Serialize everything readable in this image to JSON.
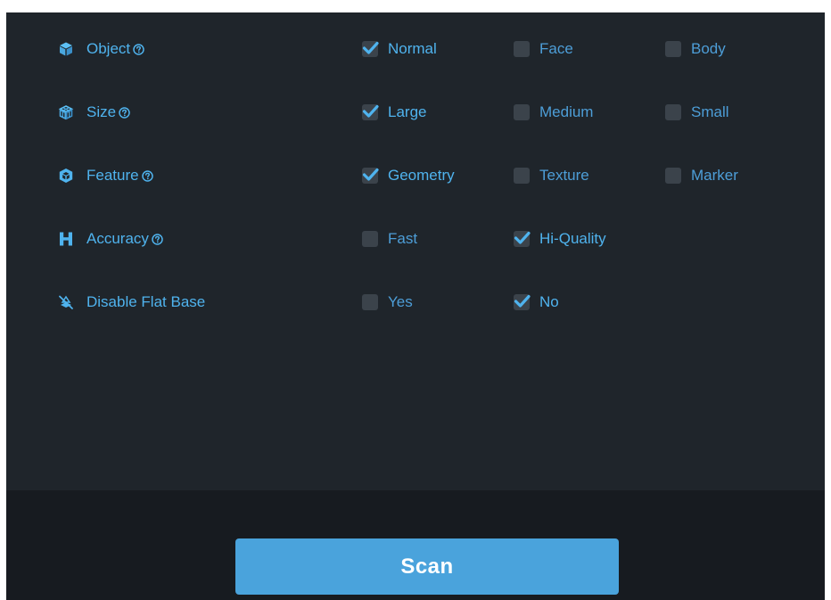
{
  "colors": {
    "panel_bg": "#1f252b",
    "footer_bg": "#171b20",
    "accent": "#4fb3ee",
    "checkbox_bg": "#3b434b",
    "scan_button_bg": "#4aa3dc"
  },
  "rows": [
    {
      "label": "Object",
      "icon": "cube-icon",
      "help": true,
      "options": [
        {
          "label": "Normal",
          "checked": true
        },
        {
          "label": "Face",
          "checked": false
        },
        {
          "label": "Body",
          "checked": false
        }
      ]
    },
    {
      "label": "Size",
      "icon": "cube-grid-icon",
      "help": true,
      "options": [
        {
          "label": "Large",
          "checked": true
        },
        {
          "label": "Medium",
          "checked": false
        },
        {
          "label": "Small",
          "checked": false
        }
      ]
    },
    {
      "label": "Feature",
      "icon": "feature-cube-icon",
      "help": true,
      "options": [
        {
          "label": "Geometry",
          "checked": true
        },
        {
          "label": "Texture",
          "checked": false
        },
        {
          "label": "Marker",
          "checked": false
        }
      ]
    },
    {
      "label": "Accuracy",
      "icon": "h-letter-icon",
      "help": true,
      "options": [
        {
          "label": "Fast",
          "checked": false
        },
        {
          "label": "Hi-Quality",
          "checked": true
        }
      ]
    },
    {
      "label": "Disable Flat Base",
      "icon": "flat-base-off-icon",
      "help": false,
      "options": [
        {
          "label": "Yes",
          "checked": false
        },
        {
          "label": "No",
          "checked": true
        }
      ]
    }
  ],
  "footer": {
    "scan_label": "Scan"
  }
}
